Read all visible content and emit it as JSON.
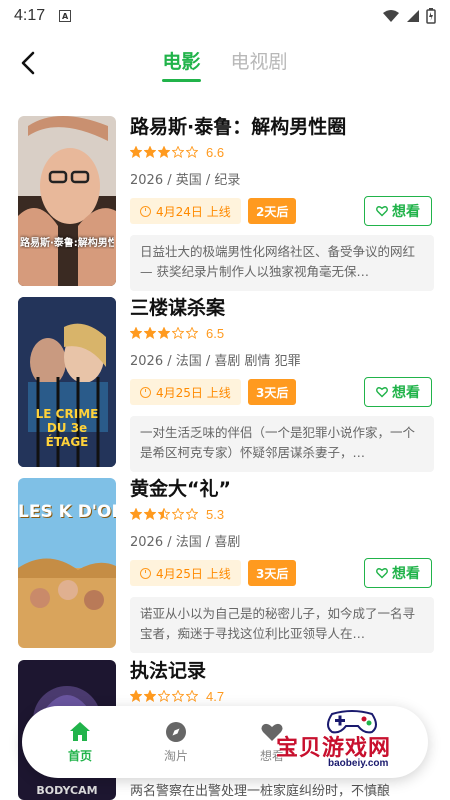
{
  "status_bar": {
    "time": "4:17",
    "notif": "A"
  },
  "header": {
    "tabs": [
      {
        "label": "电影",
        "active": true
      },
      {
        "label": "电视剧",
        "active": false
      }
    ]
  },
  "movies": [
    {
      "title": "路易斯·泰鲁：解构男性圈",
      "rating": 6.6,
      "stars": 3,
      "meta": "2026 / 英国 / 纪录",
      "date": "4月24日 上线",
      "days": "2天后",
      "want": "想看",
      "desc": "日益壮大的极端男性化网络社区、备受争议的网红 — 获奖纪录片制作人以独家视角毫无保…",
      "poster_text": "路易斯·泰鲁:解构男性圈"
    },
    {
      "title": "三楼谋杀案",
      "rating": 6.5,
      "stars": 3,
      "meta": "2026 / 法国 / 喜剧 剧情 犯罪",
      "date": "4月25日 上线",
      "days": "3天后",
      "want": "想看",
      "desc": "一对生活乏味的伴侣（一个是犯罪小说作家，一个是希区柯克专家）怀疑邻居谋杀妻子，…",
      "poster_text": "LE CRIME DU 3e ÉTAGE"
    },
    {
      "title": "黄金大“礼”",
      "rating": 5.3,
      "stars": 2.5,
      "meta": "2026 / 法国 / 喜剧",
      "date": "4月25日 上线",
      "days": "3天后",
      "want": "想看",
      "desc": "诺亚从小以为自己是的秘密儿子，如今成了一名寻宝者，痴迷于寻找这位利比亚领导人在…",
      "poster_text": "LES K D'OR"
    },
    {
      "title": "执法记录",
      "rating": 4.7,
      "stars": 2,
      "meta": "",
      "desc": "两名警察在出警处理一桩家庭纠纷时，不慎酿",
      "poster_text": "BODYCAM"
    }
  ],
  "nav": [
    {
      "label": "首页",
      "icon": "home-icon",
      "active": true
    },
    {
      "label": "淘片",
      "icon": "compass-icon",
      "active": false
    },
    {
      "label": "想看",
      "icon": "heart-icon",
      "active": false
    }
  ],
  "watermark": {
    "text": "宝贝游戏网",
    "url": "baobeiy.com"
  },
  "colors": {
    "accent": "#21b34a",
    "orange": "#ff9a1f",
    "chip_bg": "#fff3dc"
  }
}
